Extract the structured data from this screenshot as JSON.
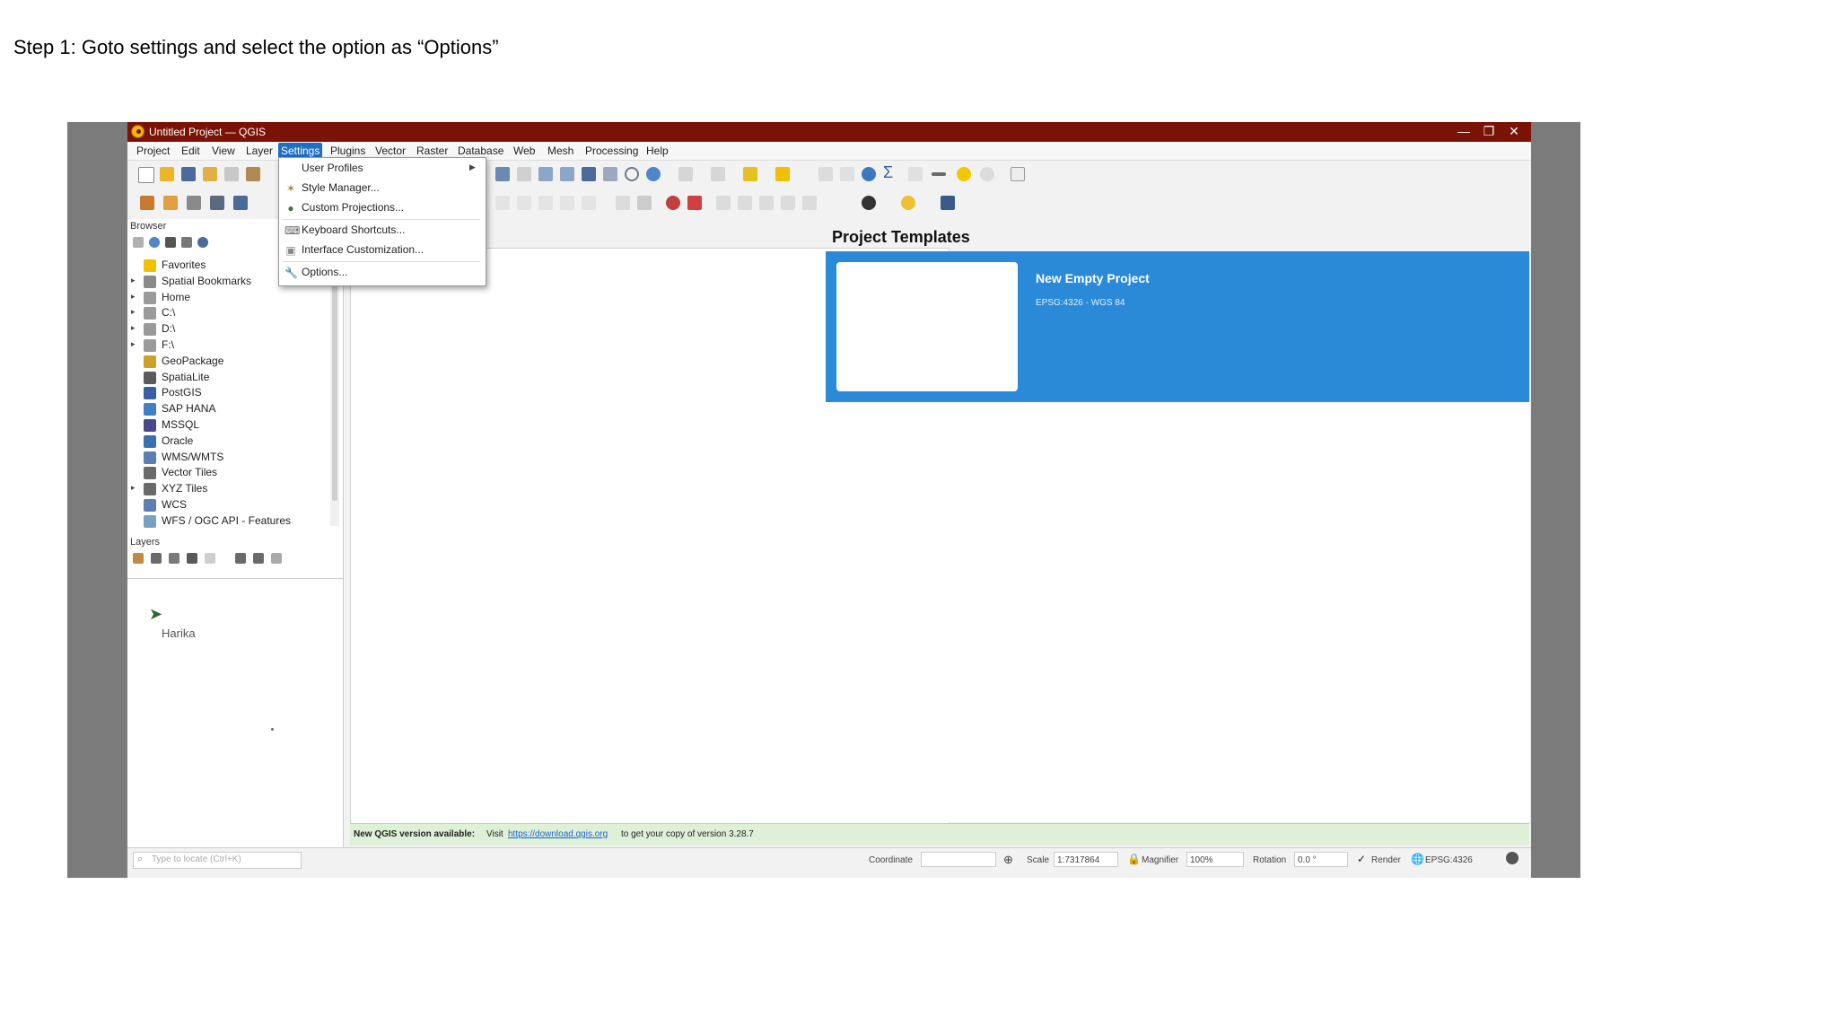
{
  "caption": "Step 1: Goto settings and select the option as “Options”",
  "window": {
    "title": "Untitled Project — QGIS",
    "controls": {
      "minimize": "—",
      "restore": "❐",
      "close": "✕"
    },
    "titlebar_color": "#7a1306"
  },
  "menubar": {
    "items": [
      "Project",
      "Edit",
      "View",
      "Layer",
      "Settings",
      "Plugins",
      "Vector",
      "Raster",
      "Database",
      "Web",
      "Mesh",
      "Processing",
      "Help"
    ],
    "active": "Settings"
  },
  "settings_menu": {
    "items": [
      {
        "label": "User Profiles",
        "icon": "none",
        "submenu": true
      },
      {
        "label": "Style Manager...",
        "icon": "style-icon"
      },
      {
        "label": "Custom Projections...",
        "icon": "globe-icon"
      },
      {
        "label": "Keyboard Shortcuts...",
        "icon": "keyboard-icon"
      },
      {
        "label": "Interface Customization...",
        "icon": "customize-icon"
      },
      {
        "label": "Options...",
        "icon": "wrench-icon"
      }
    ]
  },
  "browser": {
    "title": "Browser",
    "items": [
      {
        "label": "Favorites",
        "icon": "star-icon",
        "expandable": false,
        "color": "#f2c200"
      },
      {
        "label": "Spatial Bookmarks",
        "icon": "bookmark-icon",
        "expandable": true,
        "color": "#8a8a8a"
      },
      {
        "label": "Home",
        "icon": "home-icon",
        "expandable": true,
        "color": "#9a9a9a"
      },
      {
        "label": "C:\\",
        "icon": "drive-icon",
        "expandable": true,
        "color": "#9a9a9a"
      },
      {
        "label": "D:\\",
        "icon": "drive-icon",
        "expandable": true,
        "color": "#9a9a9a"
      },
      {
        "label": "F:\\",
        "icon": "drive-icon",
        "expandable": true,
        "color": "#9a9a9a"
      },
      {
        "label": "GeoPackage",
        "icon": "geopackage-icon",
        "expandable": false,
        "color": "#c9a227"
      },
      {
        "label": "SpatiaLite",
        "icon": "spatialite-icon",
        "expandable": false,
        "color": "#5b5b5b"
      },
      {
        "label": "PostGIS",
        "icon": "postgis-icon",
        "expandable": false,
        "color": "#3a5fa0"
      },
      {
        "label": "SAP HANA",
        "icon": "saphana-icon",
        "expandable": false,
        "color": "#3f7fc2"
      },
      {
        "label": "MSSQL",
        "icon": "mssql-icon",
        "expandable": false,
        "color": "#4a4a8a"
      },
      {
        "label": "Oracle",
        "icon": "oracle-icon",
        "expandable": false,
        "color": "#3a6fb0"
      },
      {
        "label": "WMS/WMTS",
        "icon": "wms-icon",
        "expandable": false,
        "color": "#5a7fb0"
      },
      {
        "label": "Vector Tiles",
        "icon": "vectortiles-icon",
        "expandable": false,
        "color": "#6a6a6a"
      },
      {
        "label": "XYZ Tiles",
        "icon": "xyztiles-icon",
        "expandable": true,
        "color": "#6a6a6a"
      },
      {
        "label": "WCS",
        "icon": "wcs-icon",
        "expandable": false,
        "color": "#5a7fb0"
      },
      {
        "label": "WFS / OGC API - Features",
        "icon": "wfs-icon",
        "expandable": false,
        "color": "#7a9fc0"
      }
    ]
  },
  "layers": {
    "title": "Layers",
    "watermark": "Harika"
  },
  "templates": {
    "title": "Project Templates",
    "card_name": "New Empty Project",
    "card_crs": "EPSG:4326 - WGS 84",
    "accent": "#2b8ad8"
  },
  "update_bar": {
    "prefix": "New QGIS version available:",
    "visit": "Visit",
    "link": "https://download.qgis.org",
    "suffix": "to get your copy of version 3.28.7"
  },
  "status": {
    "locate_placeholder": "Type to locate (Ctrl+K)",
    "coordinate_label": "Coordinate",
    "scale_label": "Scale",
    "scale_value": "1:7317864",
    "magnifier_label": "Magnifier",
    "magnifier_value": "100%",
    "rotation_label": "Rotation",
    "rotation_value": "0.0 °",
    "render_label": "Render",
    "crs_value": "EPSG:4326"
  }
}
